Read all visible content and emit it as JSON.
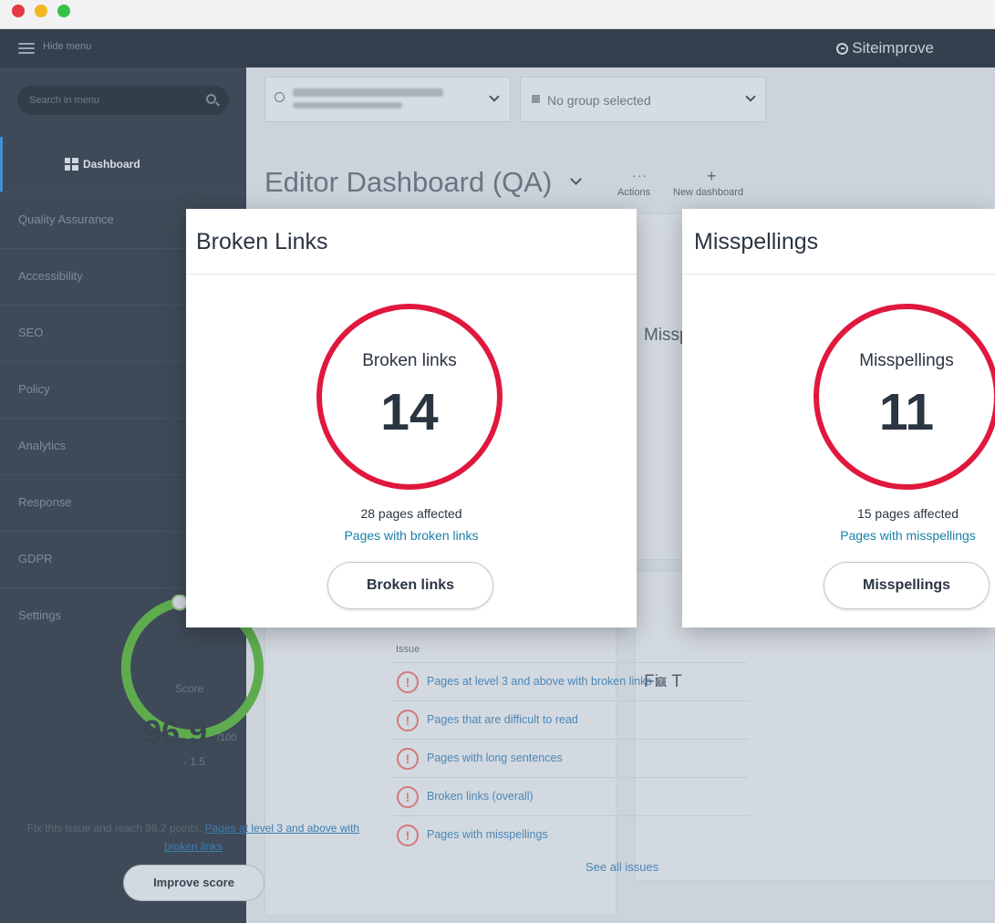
{
  "topbar": {
    "hide_menu": "Hide menu",
    "brand": "Siteimprove"
  },
  "sidebar": {
    "search_placeholder": "Search in menu",
    "active_item": "Dashboard",
    "items": [
      {
        "label": "Quality Assurance"
      },
      {
        "label": "Accessibility"
      },
      {
        "label": "SEO"
      },
      {
        "label": "Policy"
      },
      {
        "label": "Analytics"
      },
      {
        "label": "Response"
      },
      {
        "label": "GDPR"
      },
      {
        "label": "Settings"
      }
    ]
  },
  "header": {
    "group_selector": "No group selected",
    "dashboard_title": "Editor Dashboard (QA)",
    "actions_label": "Actions",
    "new_dashboard_label": "New dashboard"
  },
  "background_cards": {
    "misspellings_title": "Missp",
    "fix_title": "Fix T"
  },
  "score": {
    "label": "Score",
    "value": "96.9",
    "max": "/100",
    "delta": "- 1.5",
    "hint_prefix": "Fix this issue and reach 98.2 points: ",
    "hint_link": "Pages at level 3 and above with broken links",
    "improve_button": "Improve score",
    "level": 0.969
  },
  "issues": {
    "column_header": "Issue",
    "items": [
      {
        "label": "Pages at level 3 and above with broken links"
      },
      {
        "label": "Pages that are difficult to read"
      },
      {
        "label": "Pages with long sentences"
      },
      {
        "label": "Broken links (overall)"
      },
      {
        "label": "Pages with misspellings"
      }
    ],
    "see_all": "See all issues"
  },
  "cards": {
    "broken_links": {
      "title": "Broken Links",
      "metric_label": "Broken links",
      "metric_value": "14",
      "pages_affected": "28 pages affected",
      "link": "Pages with broken links",
      "button": "Broken links"
    },
    "misspellings": {
      "title": "Misspellings",
      "metric_label": "Misspellings",
      "metric_value": "11",
      "pages_affected": "15 pages affected",
      "link": "Pages with misspellings",
      "button": "Misspellings"
    }
  },
  "colors": {
    "accent_red": "#e0183d",
    "link_blue": "#1a7fa6",
    "score_green": "#5eac4e",
    "sidebar_bg": "#3f4a58",
    "topbar_bg": "#34404e"
  }
}
